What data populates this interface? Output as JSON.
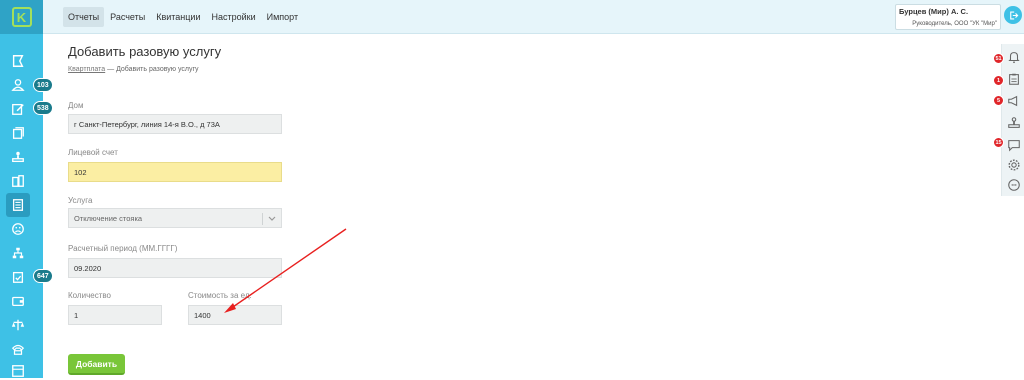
{
  "app": {
    "logo_letter": "K",
    "accent_color": "#3ec1e6",
    "brand_green": "#79c639"
  },
  "topbar": {
    "menu": [
      {
        "label": "Отчеты",
        "active": true
      },
      {
        "label": "Расчеты",
        "active": false
      },
      {
        "label": "Квитанции",
        "active": false
      },
      {
        "label": "Настройки",
        "active": false
      },
      {
        "label": "Импорт",
        "active": false
      }
    ],
    "user": {
      "name": "Бурцев (Мир) А. С.",
      "role": "Руководитель, ООО \"УК \"Мир\""
    },
    "logout_icon": "logout-icon"
  },
  "sidebar": {
    "badges": [
      "103",
      "538",
      "647"
    ],
    "icons": [
      "flag-icon",
      "people-icon",
      "edit-icon",
      "documents-icon",
      "stamp-icon",
      "buildings-icon",
      "calculator-icon",
      "sad-face-icon",
      "hierarchy-icon",
      "clipboard-check-icon",
      "wallet-icon",
      "scales-icon",
      "phone-icon",
      "table-icon"
    ]
  },
  "rightbar": {
    "items": [
      {
        "icon": "bell-icon",
        "badge": "51"
      },
      {
        "icon": "clipboard-icon",
        "badge": "1"
      },
      {
        "icon": "megaphone-icon",
        "badge": "5"
      },
      {
        "icon": "stamp-icon",
        "badge": ""
      },
      {
        "icon": "chat-icon",
        "badge": "15"
      },
      {
        "icon": "gear-icon",
        "badge": ""
      },
      {
        "icon": "support-chat-icon",
        "badge": ""
      }
    ]
  },
  "page": {
    "title": "Добавить разовую услугу",
    "breadcrumb_link": "Квартплата",
    "breadcrumb_sep": " — ",
    "breadcrumb_current": "Добавить разовую услугу"
  },
  "form": {
    "house_label": "Дом",
    "house_value": "г Санкт-Петербург, линия 14-я В.О., д 73А",
    "account_label": "Лицевой счет",
    "account_value": "102",
    "service_label": "Услуга",
    "service_value": "Отключение стояка",
    "period_label": "Расчетный период (ММ.ГГГГ)",
    "period_value": "09.2020",
    "quantity_label": "Количество",
    "quantity_value": "1",
    "price_label": "Стоимость за ед.",
    "price_value": "1400",
    "submit_label": "Добавить"
  }
}
